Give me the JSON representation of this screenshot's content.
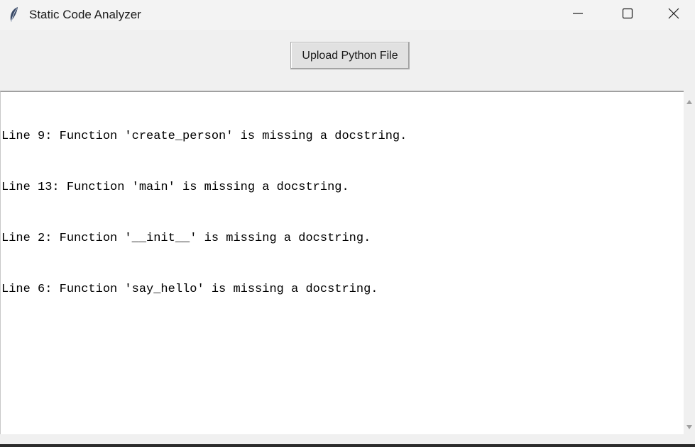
{
  "window": {
    "title": "Static Code Analyzer",
    "icon": "feather-icon"
  },
  "controls": {
    "minimize_icon": "minimize-icon",
    "maximize_icon": "maximize-icon",
    "close_icon": "close-icon"
  },
  "toolbar": {
    "upload_label": "Upload Python File"
  },
  "output": {
    "lines": [
      "Line 9: Function 'create_person' is missing a docstring.",
      "Line 13: Function 'main' is missing a docstring.",
      "Line 2: Function '__init__' is missing a docstring.",
      "Line 6: Function 'say_hello' is missing a docstring."
    ]
  },
  "colors": {
    "background": "#f0f0f0",
    "titlebar": "#f3f3f3",
    "text_area": "#ffffff",
    "button": "#e1e1e1"
  }
}
